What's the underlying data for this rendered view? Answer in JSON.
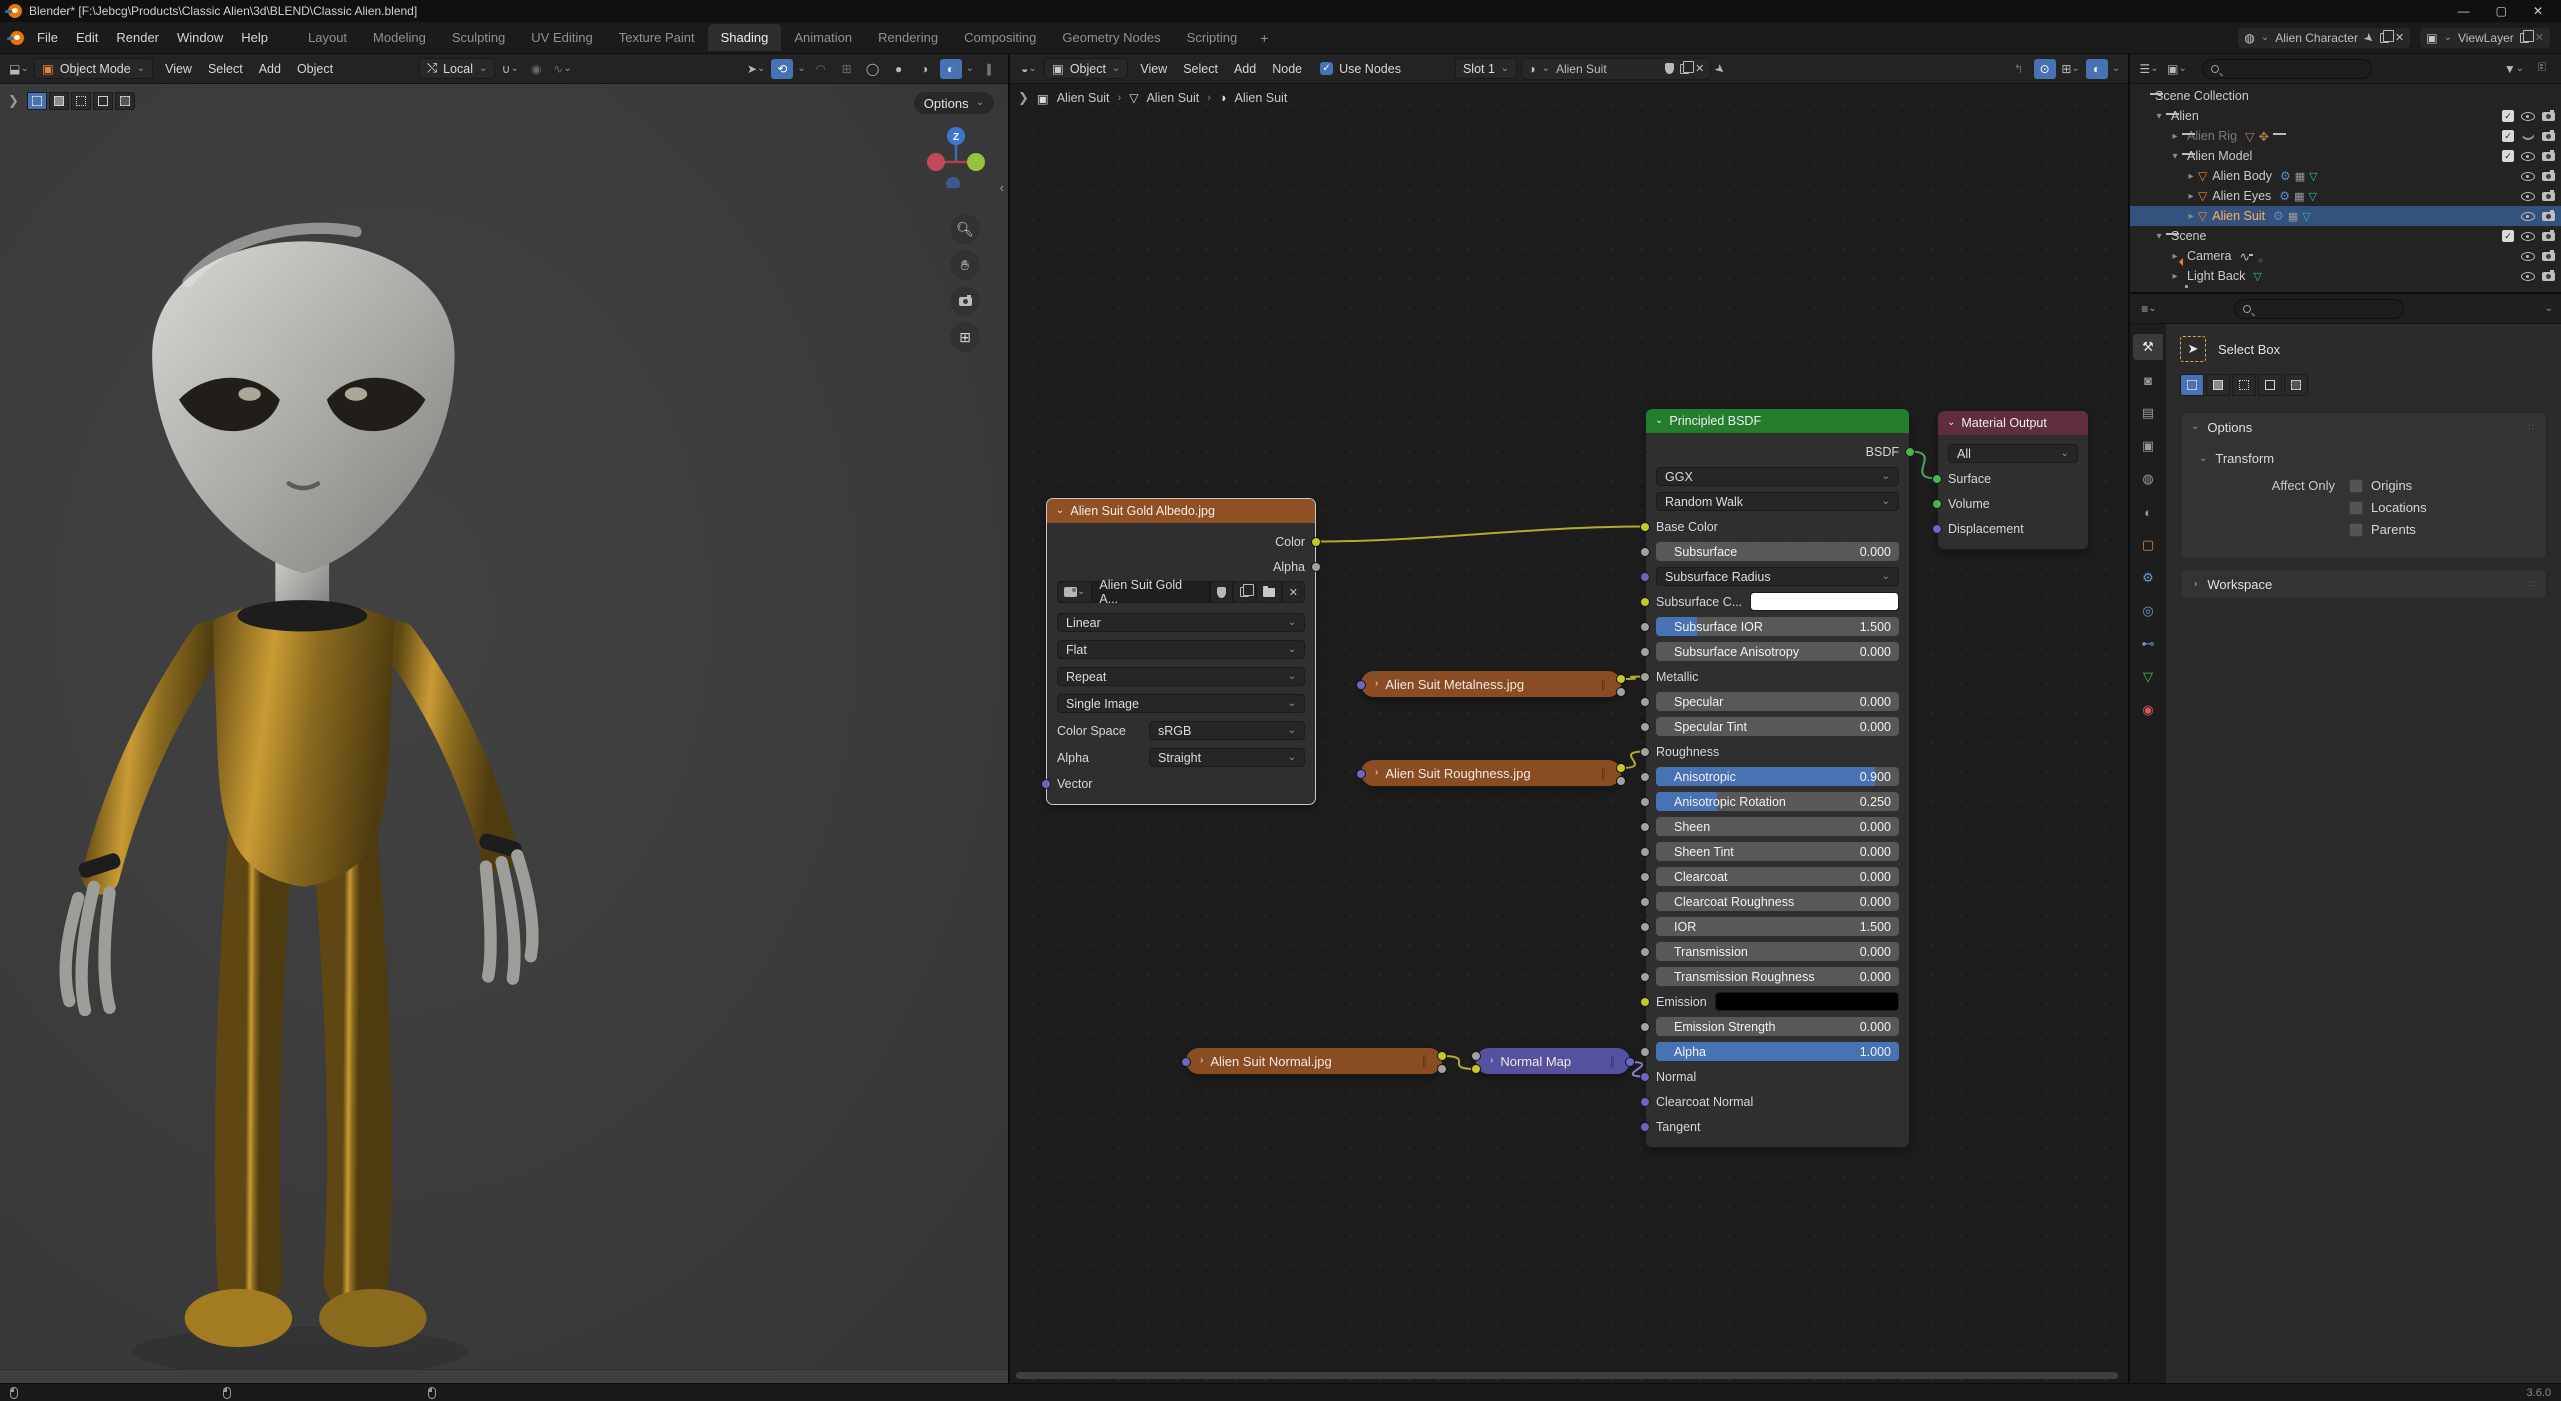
{
  "window": {
    "title": "Blender* [F:\\Jebcg\\Products\\Classic Alien\\3d\\BLEND\\Classic Alien.blend]",
    "controls": {
      "minimize": "—",
      "maximize": "▢",
      "close": "✕"
    }
  },
  "topbar": {
    "menus": [
      "File",
      "Edit",
      "Render",
      "Window",
      "Help"
    ],
    "workspaces": [
      "Layout",
      "Modeling",
      "Sculpting",
      "UV Editing",
      "Texture Paint",
      "Shading",
      "Animation",
      "Rendering",
      "Compositing",
      "Geometry Nodes",
      "Scripting"
    ],
    "active_workspace": "Shading",
    "add_workspace": "+",
    "scene_name": "Alien Character",
    "view_layer_name": "ViewLayer"
  },
  "viewport": {
    "mode": "Object Mode",
    "menus": [
      "View",
      "Select",
      "Add",
      "Object"
    ],
    "orientation": "Local",
    "options_label": "Options",
    "gizmo_axis_label": "Z"
  },
  "node_editor": {
    "editor_type": "Object",
    "menus": [
      "View",
      "Select",
      "Add",
      "Node"
    ],
    "use_nodes_label": "Use Nodes",
    "slot": "Slot 1",
    "material_name": "Alien Suit",
    "breadcrumb": [
      "Alien Suit",
      "Alien Suit",
      "Alien Suit"
    ],
    "nodes": {
      "albedo": {
        "title": "Alien Suit Gold Albedo.jpg",
        "outputs": [
          {
            "label": "Color",
            "socket": "yellow",
            "id": "color"
          },
          {
            "label": "Alpha",
            "socket": "gray",
            "id": "alpha"
          }
        ],
        "image_name": "Alien Suit Gold A...",
        "dropdowns": [
          "Linear",
          "Flat",
          "Repeat",
          "Single Image"
        ],
        "color_space_label": "Color Space",
        "color_space_value": "sRGB",
        "alpha_label": "Alpha",
        "alpha_value": "Straight",
        "input_label": "Vector"
      },
      "metalness": {
        "title": "Alien Suit Metalness.jpg"
      },
      "roughness": {
        "title": "Alien Suit Roughness.jpg"
      },
      "normaltex": {
        "title": "Alien Suit Normal.jpg"
      },
      "normalmap": {
        "title": "Normal Map"
      },
      "bsdf": {
        "title": "Principled BSDF",
        "rows": [
          {
            "kind": "output",
            "label": "BSDF",
            "socket": "green",
            "id": "bsdf"
          },
          {
            "kind": "dropdown",
            "label": "GGX"
          },
          {
            "kind": "dropdown",
            "label": "Random Walk"
          },
          {
            "kind": "label",
            "label": "Base Color",
            "socket": "yellow",
            "id": "base-color"
          },
          {
            "kind": "slider",
            "label": "Subsurface",
            "value": "0.000",
            "fill": 0,
            "socket": "gray"
          },
          {
            "kind": "dropdown",
            "label": "Subsurface Radius",
            "socket": "purple"
          },
          {
            "kind": "color",
            "label": "Subsurface C...",
            "swatch": "#ffffff",
            "socket": "yellow"
          },
          {
            "kind": "slider",
            "label": "Subsurface IOR",
            "value": "1.500",
            "fill": 17,
            "socket": "gray"
          },
          {
            "kind": "slider",
            "label": "Subsurface Anisotropy",
            "value": "0.000",
            "fill": 0,
            "socket": "gray"
          },
          {
            "kind": "label",
            "label": "Metallic",
            "socket": "gray",
            "id": "metallic"
          },
          {
            "kind": "slider",
            "label": "Specular",
            "value": "0.000",
            "fill": 0,
            "socket": "gray"
          },
          {
            "kind": "slider",
            "label": "Specular Tint",
            "value": "0.000",
            "fill": 0,
            "socket": "gray"
          },
          {
            "kind": "label",
            "label": "Roughness",
            "socket": "gray",
            "id": "roughness"
          },
          {
            "kind": "slider",
            "label": "Anisotropic",
            "value": "0.900",
            "fill": 90,
            "socket": "gray"
          },
          {
            "kind": "slider",
            "label": "Anisotropic Rotation",
            "value": "0.250",
            "fill": 25,
            "socket": "gray"
          },
          {
            "kind": "slider",
            "label": "Sheen",
            "value": "0.000",
            "fill": 0,
            "socket": "gray"
          },
          {
            "kind": "slider",
            "label": "Sheen Tint",
            "value": "0.000",
            "fill": 0,
            "socket": "gray"
          },
          {
            "kind": "slider",
            "label": "Clearcoat",
            "value": "0.000",
            "fill": 0,
            "socket": "gray"
          },
          {
            "kind": "slider",
            "label": "Clearcoat Roughness",
            "value": "0.000",
            "fill": 0,
            "socket": "gray"
          },
          {
            "kind": "slider",
            "label": "IOR",
            "value": "1.500",
            "fill": 0,
            "socket": "gray"
          },
          {
            "kind": "slider",
            "label": "Transmission",
            "value": "0.000",
            "fill": 0,
            "socket": "gray"
          },
          {
            "kind": "slider",
            "label": "Transmission Roughness",
            "value": "0.000",
            "fill": 0,
            "socket": "gray"
          },
          {
            "kind": "color",
            "label": "Emission",
            "swatch": "#000000",
            "socket": "yellow"
          },
          {
            "kind": "slider",
            "label": "Emission Strength",
            "value": "0.000",
            "fill": 0,
            "socket": "gray"
          },
          {
            "kind": "slider",
            "label": "Alpha",
            "value": "1.000",
            "fill": 100,
            "socket": "gray"
          },
          {
            "kind": "label",
            "label": "Normal",
            "socket": "purple",
            "id": "normal"
          },
          {
            "kind": "label",
            "label": "Clearcoat Normal",
            "socket": "purple"
          },
          {
            "kind": "label",
            "label": "Tangent",
            "socket": "purple"
          }
        ]
      },
      "output": {
        "title": "Material Output",
        "dropdown": "All",
        "inputs": [
          {
            "label": "Surface",
            "socket": "green",
            "id": "surface"
          },
          {
            "label": "Volume",
            "socket": "green",
            "id": "volume"
          },
          {
            "label": "Displacement",
            "socket": "purple",
            "id": "displacement"
          }
        ]
      }
    },
    "links": [
      {
        "from": "albedo.color",
        "to": "bsdf.base-color",
        "color": "#b3ab2a"
      },
      {
        "from": "metalness.color",
        "to": "bsdf.metallic",
        "color": "#b3ab2a"
      },
      {
        "from": "roughness.color",
        "to": "bsdf.roughness",
        "color": "#b3ab2a"
      },
      {
        "from": "normaltex.color",
        "to": "normalmap.color",
        "color": "#b3ab2a"
      },
      {
        "from": "normalmap.normal",
        "to": "bsdf.normal",
        "color": "#8a88cf"
      },
      {
        "from": "bsdf.bsdf",
        "to": "output.surface",
        "color": "#4ea35b"
      }
    ]
  },
  "outliner": {
    "rows": [
      {
        "label": "Scene Collection",
        "icon": "collection",
        "depth": 0,
        "disc": "none"
      },
      {
        "label": "Alien",
        "icon": "collection",
        "depth": 1,
        "disc": "open",
        "checkbox": true,
        "eye": "open",
        "camera": true
      },
      {
        "label": "Alien Rig",
        "icon": "collection",
        "depth": 2,
        "disc": "closed",
        "muted": true,
        "checkbox": true,
        "eye": "closed",
        "camera": true,
        "extras": [
          "armature-data",
          "pose",
          "collection"
        ]
      },
      {
        "label": "Alien Model",
        "icon": "collection",
        "depth": 2,
        "disc": "open",
        "checkbox": true,
        "eye": "open",
        "camera": true
      },
      {
        "label": "Alien Body",
        "icon": "mesh",
        "depth": 3,
        "disc": "closed",
        "eye": "open",
        "camera": true,
        "extras": [
          "modifier-wrench",
          "geometry-nodes",
          "mesh-data"
        ]
      },
      {
        "label": "Alien Eyes",
        "icon": "mesh",
        "depth": 3,
        "disc": "closed",
        "eye": "open",
        "camera": true,
        "extras": [
          "modifier-wrench",
          "geometry-nodes",
          "mesh-data"
        ]
      },
      {
        "label": "Alien Suit",
        "icon": "mesh",
        "depth": 3,
        "disc": "closed",
        "selected": true,
        "eye": "open",
        "camera": true,
        "extras": [
          "modifier-wrench",
          "geometry-nodes",
          "mesh-data"
        ]
      },
      {
        "label": "Scene",
        "icon": "collection",
        "depth": 1,
        "disc": "open",
        "checkbox": true,
        "eye": "open",
        "camera": true
      },
      {
        "label": "Camera",
        "icon": "camera-object",
        "depth": 2,
        "disc": "closed",
        "eye": "open",
        "camera": true,
        "extras": [
          "animation",
          "camera-data"
        ]
      },
      {
        "label": "Light Back",
        "icon": "light-object",
        "depth": 2,
        "disc": "closed",
        "eye": "open",
        "camera": true,
        "extras": [
          "light-data"
        ]
      }
    ]
  },
  "properties": {
    "tool_name": "Select Box",
    "tabs": [
      "tool",
      "render",
      "output",
      "view-layer",
      "scene",
      "world",
      "object",
      "modifiers",
      "physics",
      "constraints",
      "object-data",
      "material"
    ],
    "active_tab": "tool",
    "options_panel": "Options",
    "transform_panel": "Transform",
    "affect_only_label": "Affect Only",
    "affect_checkboxes": [
      "Origins",
      "Locations",
      "Parents"
    ],
    "workspace_panel": "Workspace"
  },
  "statusbar": {
    "version": "3.6.0"
  },
  "colors": {
    "accent_blue": "#4772b3",
    "texture_node_header": "#915023",
    "shader_node_header": "#237d2d",
    "vector_node_header": "#54519f",
    "output_node_header": "#5f2d3e",
    "outliner_selection": "#33527d",
    "active_object_text": "#ffb258"
  }
}
